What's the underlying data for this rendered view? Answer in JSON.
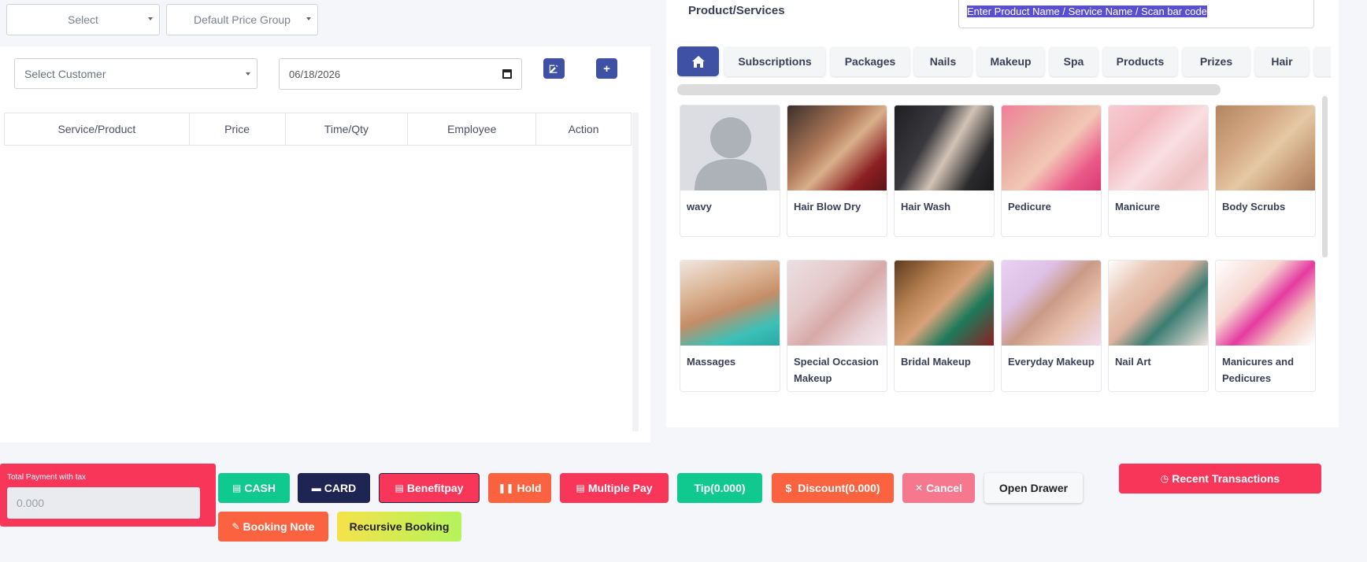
{
  "top_selects": {
    "type_select": "Select",
    "price_group": "Default Price Group"
  },
  "customer": {
    "placeholder": "Select Customer",
    "date": "06/18/2026"
  },
  "table": {
    "headers": [
      "Service/Product",
      "Price",
      "Time/Qty",
      "Employee",
      "Action"
    ]
  },
  "product_services": {
    "label": "Product/Services",
    "search_placeholder": "Enter Product Name / Service Name / Scan bar code"
  },
  "tabs": [
    "Subscriptions",
    "Packages",
    "Nails",
    "Makeup",
    "Spa",
    "Products",
    "Prizes",
    "Hair"
  ],
  "products": [
    {
      "name": "wavy",
      "icon": "placeholder-person"
    },
    {
      "name": "Hair Blow Dry"
    },
    {
      "name": "Hair Wash"
    },
    {
      "name": "Pedicure"
    },
    {
      "name": "Manicure"
    },
    {
      "name": "Body Scrubs"
    },
    {
      "name": "Massages"
    },
    {
      "name": "Special Occasion Makeup"
    },
    {
      "name": "Bridal Makeup"
    },
    {
      "name": "Everyday Makeup"
    },
    {
      "name": "Nail Art"
    },
    {
      "name": "Manicures and Pedicures"
    }
  ],
  "total": {
    "label": "Total Payment with tax",
    "value": "0.000"
  },
  "actions": {
    "cash": "CASH",
    "card": "CARD",
    "benefitpay": "Benefitpay",
    "hold": "Hold",
    "multiple_pay": "Multiple Pay",
    "tip": "Tip(0.000)",
    "discount": "Discount(0.000)",
    "cancel": "Cancel",
    "open_drawer": "Open Drawer",
    "booking_note": "Booking Note",
    "recursive_booking": "Recursive Booking",
    "recent_transactions": "Recent Transactions"
  },
  "colors": {
    "primary": "#3f51a5",
    "cash": "#10c98f",
    "card": "#1e2552",
    "danger": "#f7365a",
    "warning": "#fb6340",
    "cancel": "#f5788f"
  }
}
